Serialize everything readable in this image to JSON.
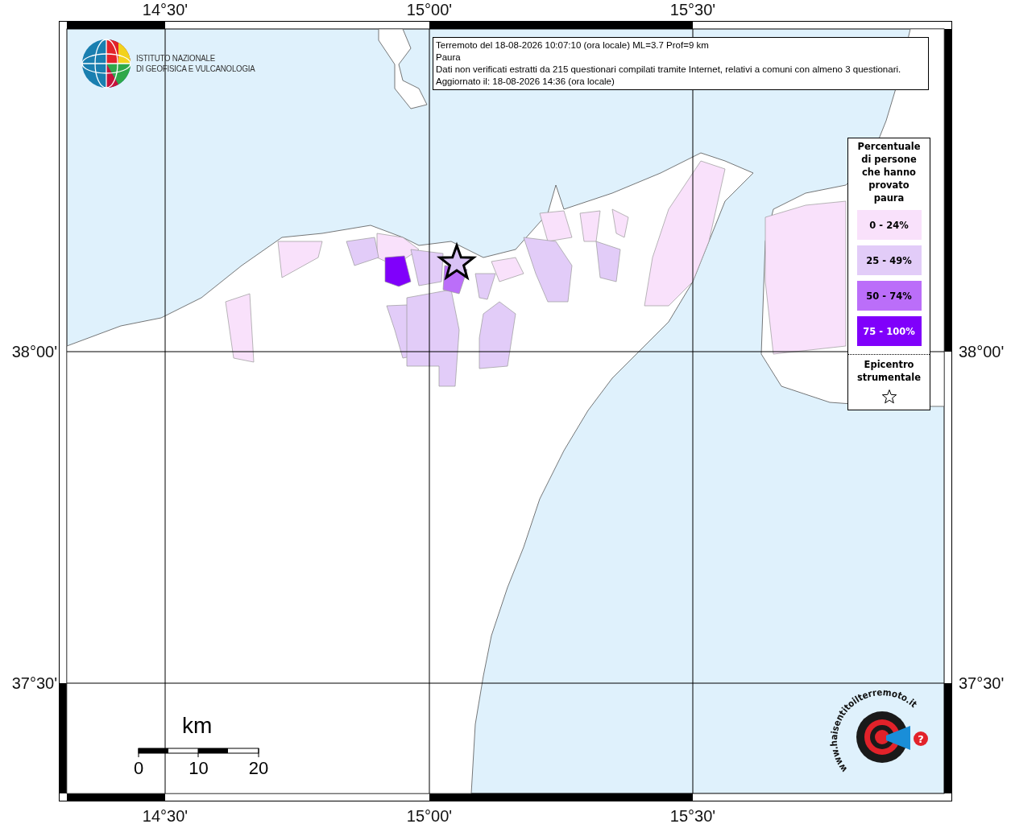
{
  "axes": {
    "top": [
      "14°30'",
      "15°00'",
      "15°30'"
    ],
    "bottom": [
      "14°30'",
      "15°00'",
      "15°30'"
    ],
    "left": [
      "38°00'",
      "37°30'"
    ],
    "right": [
      "38°00'",
      "37°30'"
    ]
  },
  "institute_logo": {
    "lines": [
      "ISTITUTO NAZIONALE",
      "DI GEOFISICA E VULCANOLOGIA"
    ]
  },
  "info_box": {
    "lines": [
      "Terremoto del 18-08-2026 10:07:10 (ora locale) ML=3.7 Prof=9 km",
      "Paura",
      "Dati non verificati estratti da 215 questionari compilati tramite Internet, relativi a comuni con almeno 3 questionari.",
      "Aggiornato il: 18-08-2026 14:36 (ora locale)"
    ]
  },
  "legend": {
    "title": "Percentuale di persone che hanno provato paura",
    "classes": [
      {
        "label": "0 - 24%",
        "color": "#f9e1fb"
      },
      {
        "label": "25 - 49%",
        "color": "#e2ccf8"
      },
      {
        "label": "50 - 74%",
        "color": "#bb6ef9"
      },
      {
        "label": "75 - 100%",
        "color": "#8000fb"
      }
    ],
    "epicenter_label": "Epicentro strumentale"
  },
  "scale_bar": {
    "unit": "km",
    "ticks": [
      "0",
      "10",
      "20"
    ]
  },
  "site_logo": {
    "text": "www.haisentitoilterremoto.it",
    "badge": "?"
  }
}
